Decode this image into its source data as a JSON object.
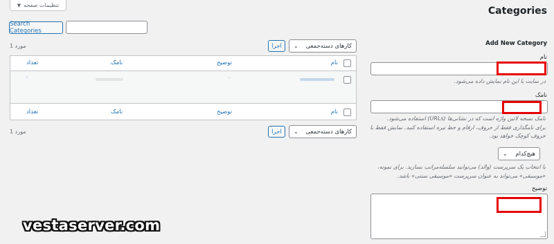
{
  "screen_options": {
    "label": "تنظیمات صفحه",
    "icon": "triangle-down-icon"
  },
  "page_title": "Categories",
  "search": {
    "button": "Search Categories",
    "placeholder": ""
  },
  "bulk": {
    "top": {
      "select_label": "کارهای دسته‌جمعی",
      "apply": "اجرا",
      "count": "1 مورد"
    },
    "bottom": {
      "select_label": "کارهای دسته‌جمعی",
      "apply": "اجرا",
      "count": "1 مورد"
    }
  },
  "table": {
    "columns": {
      "name": "نام",
      "desc": "توضیح",
      "slug": "نامک",
      "count": "تعداد"
    },
    "row": {
      "name": "",
      "desc": "—",
      "slug": "",
      "count": "0"
    }
  },
  "form": {
    "heading": "Add New Category",
    "name_label": "نام",
    "name_help": "در سایت با این نام نمایش داده می‌شود.",
    "slug_label": "نامک",
    "slug_help": [
      "نامک نسخه لاتین واژه است که در نشانی‌ها (URLs) استفاده می‌شود.",
      "برای نامگذاری فقط از حروف، ارقام و خط تیره استفاده کنید. نمایش فقط با",
      "حروف کوچک خواهد بود."
    ],
    "parent_select": "هیچ‌کدام",
    "parent_help": [
      "با انتخاب یک سرپرست (والد) می‌توانید سلسله‌مراتب بسازید. برای نمونه،",
      "«موسیقی» می‌تواند به عنوان سرپرست «موسیقی سنتی» باشد."
    ],
    "desc_label": "توضیح"
  },
  "watermark": "vestaserver.com",
  "colors": {
    "accent": "#2271b1",
    "highlight": "#e60000",
    "watermark": "#ffffff"
  }
}
